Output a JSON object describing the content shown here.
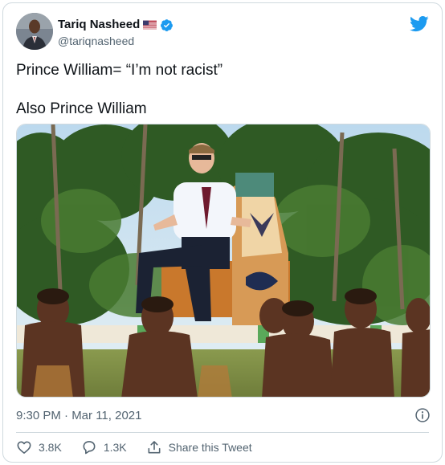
{
  "tweet": {
    "author": {
      "display_name": "Tariq Nasheed",
      "handle": "@tariqnasheed",
      "flag": "US",
      "verified": true
    },
    "text_lines": [
      "Prince William= “I’m not racist”",
      "Also Prince William"
    ],
    "timestamp": "9:30 PM · Mar 11, 2021",
    "actions": {
      "like_count": "3.8K",
      "reply_count": "1.3K",
      "share_label": "Share this Tweet"
    }
  },
  "icons": {
    "brand": "twitter-bird-icon",
    "info": "info-icon",
    "like": "heart-icon",
    "reply": "reply-bubble-icon",
    "share": "share-icon",
    "verified": "verified-badge-icon"
  },
  "colors": {
    "brand_blue": "#1d9bf0",
    "text_primary": "#0f1419",
    "text_secondary": "#536471",
    "border": "#cfd9de"
  }
}
